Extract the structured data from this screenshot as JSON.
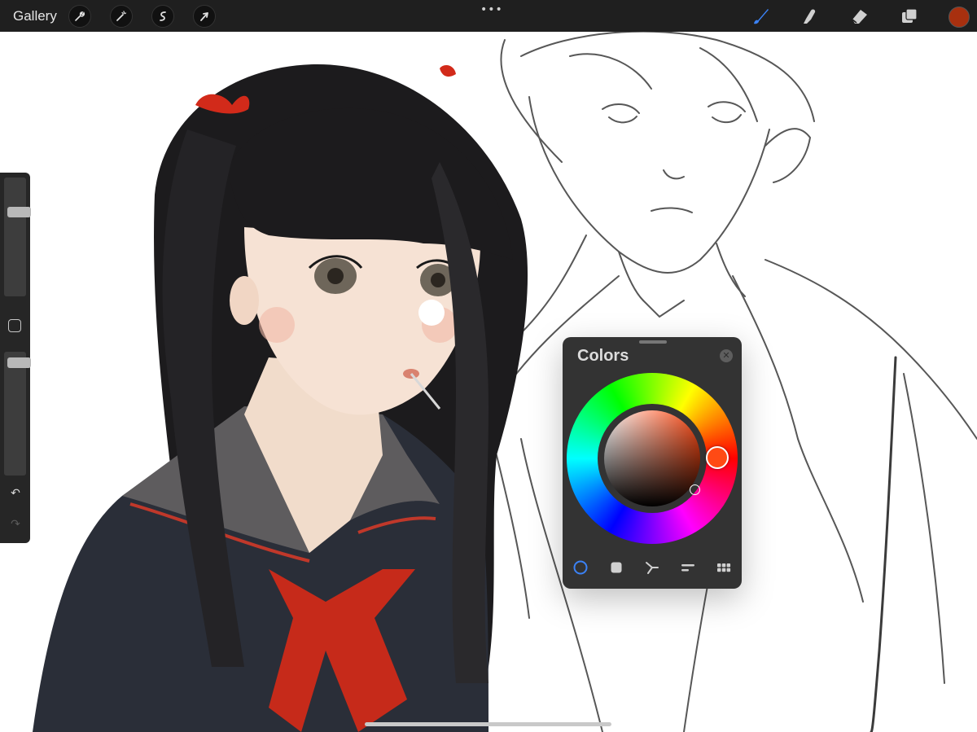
{
  "toolbar": {
    "gallery_label": "Gallery",
    "left_tools": [
      {
        "name": "actions",
        "icon": "wrench-icon"
      },
      {
        "name": "adjustments",
        "icon": "magic-wand-icon"
      },
      {
        "name": "selection",
        "icon": "selection-s-icon"
      },
      {
        "name": "transform",
        "icon": "arrow-cursor-icon"
      }
    ],
    "more_label": "•••",
    "right_tools": [
      {
        "name": "brush",
        "icon": "brush-icon",
        "active": true
      },
      {
        "name": "smudge",
        "icon": "smudge-finger-icon",
        "active": false
      },
      {
        "name": "eraser",
        "icon": "eraser-icon",
        "active": false
      },
      {
        "name": "layers",
        "icon": "layers-icon",
        "active": false
      }
    ],
    "current_color": "#a8300f",
    "active_color": "#3b82f6"
  },
  "sidebar": {
    "brush_size": 0.73,
    "brush_opacity": 0.95,
    "modify_icon": "square-icon",
    "undo_icon": "undo-arrow-icon",
    "redo_icon": "redo-arrow-icon",
    "undo_glyph": "↶",
    "redo_glyph": "↷"
  },
  "colors_panel": {
    "title": "Colors",
    "close_glyph": "✕",
    "selected_hue_color": "#ff4a14",
    "modes": [
      {
        "name": "disc",
        "icon": "disc-icon",
        "active": true
      },
      {
        "name": "classic",
        "icon": "classic-square-icon",
        "active": false
      },
      {
        "name": "harmony",
        "icon": "harmony-icon",
        "active": false
      },
      {
        "name": "value",
        "icon": "value-sliders-icon",
        "active": false
      },
      {
        "name": "palettes",
        "icon": "palettes-grid-icon",
        "active": false
      }
    ]
  }
}
